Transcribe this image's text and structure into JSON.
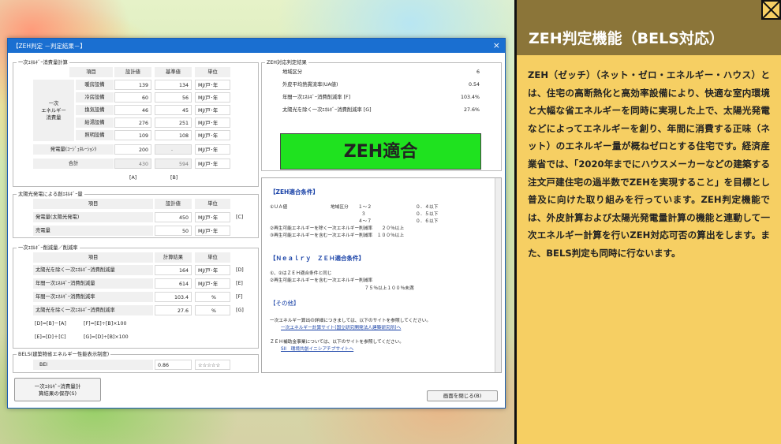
{
  "side_panel": {
    "title": "ZEH判定機能（BELS対応）",
    "body": "ZEH（ゼッチ）（ネット・ゼロ・エネルギー・ハウス）とは、住宅の高断熱化と高効率設備により、快適な室内環境と大幅な省エネルギーを同時に実現した上で、太陽光発電などによってエネルギーを創り、年間に消費する正味（ネット）のエネルギー量が概ねゼロとする住宅です。経済産業省では、「2020年までにハウスメーカーなどの建築する注文戸建住宅の過半数でZEHを実現すること」を目標とし普及に向けた取り組みを行っています。ZEH判定機能では、外皮計算および太陽光発電量計算の機能と連動して一次エネルギー計算を行いZEH対応可否の算出をします。また、BELS判定も同時に行ないます。"
  },
  "window": {
    "title": "【ZEH判定 －判定結果－】",
    "close": "×",
    "primary": {
      "label": "一次ｴﾈﾙｷﾞｰ消費量計算",
      "headers": [
        "項目",
        "設計値",
        "基準値",
        "単位"
      ],
      "group_label": "一次\nエネルギー\n消費量",
      "rows": [
        {
          "name": "暖房設備",
          "design": "139",
          "base": "134",
          "unit": "MJ/戸･年"
        },
        {
          "name": "冷房設備",
          "design": "60",
          "base": "56",
          "unit": "MJ/戸･年"
        },
        {
          "name": "換気設備",
          "design": "46",
          "base": "45",
          "unit": "MJ/戸･年"
        },
        {
          "name": "給湯設備",
          "design": "276",
          "base": "251",
          "unit": "MJ/戸･年"
        },
        {
          "name": "照明設備",
          "design": "109",
          "base": "108",
          "unit": "MJ/戸･年"
        }
      ],
      "cogen": {
        "name": "発電量(ｺｰｼﾞｪﾈﾚｰｼｮﾝ)",
        "design": "200",
        "base": "-",
        "unit": "MJ/戸･年"
      },
      "total": {
        "name": "合計",
        "design": "430",
        "base": "594",
        "unit": "MJ/戸･年"
      },
      "marks": [
        "[A]",
        "[B]"
      ]
    },
    "solar": {
      "label": "太陽光発電による創ｴﾈﾙｷﾞｰ量",
      "headers": [
        "項目",
        "設計値",
        "単位"
      ],
      "rows": [
        {
          "name": "発電量(太陽光発電)",
          "value": "450",
          "unit": "MJ/戸･年",
          "mark": "[C]"
        },
        {
          "name": "売電量",
          "value": "50",
          "unit": "MJ/戸･年",
          "mark": ""
        }
      ]
    },
    "reduction": {
      "label": "一次ｴﾈﾙｷﾞｰ削減量／削減率",
      "headers": [
        "項目",
        "計算結果",
        "単位"
      ],
      "rows": [
        {
          "name": "太陽光を除く一次ｴﾈﾙｷﾞｰ消費削減量",
          "value": "164",
          "unit": "MJ/戸･年",
          "mark": "[D]"
        },
        {
          "name": "年間一次ｴﾈﾙｷﾞｰ消費削減量",
          "value": "614",
          "unit": "MJ/戸･年",
          "mark": "[E]"
        },
        {
          "name": "年間一次ｴﾈﾙｷﾞｰ消費削減率",
          "value": "103.4",
          "unit": "%",
          "mark": "[F]"
        },
        {
          "name": "太陽光を除く一次ｴﾈﾙｷﾞｰ消費削減率",
          "value": "27.6",
          "unit": "%",
          "mark": "[G]"
        }
      ],
      "formulas": [
        "[D]=[B]－[A]",
        "[F]=[E]÷[B]×100",
        "[E]=[D]＋[C]",
        "[G]=[D]÷[B]×100"
      ]
    },
    "bels": {
      "label": "BELS(建築物省エネルギー性能表示制度)",
      "name": "BEI",
      "value": "0.86",
      "stars": "☆☆☆☆☆"
    },
    "save_button": "一次ｴﾈﾙｷﾞｰ消費量計\n算結果の保存(S)",
    "close_button": "画面を閉じる(B)",
    "result": {
      "label": "ZEH対応判定結果",
      "rows": [
        {
          "name": "地域区分",
          "value": "6"
        },
        {
          "name": "外皮平均熱貫流率(UA値)",
          "value": "0.54"
        },
        {
          "name": "年間一次ｴﾈﾙｷﾞｰ消費削減率 [F]",
          "value": "103.4%"
        },
        {
          "name": "太陽光を除く一次ｴﾈﾙｷﾞｰ消費削減率 [G]",
          "value": "27.6%"
        }
      ],
      "verdict": "ZEH適合"
    },
    "conditions": {
      "zeh_title": "【ZEH適合条件】",
      "ua_label": "①ＵＡ値",
      "region_label": "地域区分",
      "ua_rows": [
        {
          "region": "１～２",
          "value": "０．４以下"
        },
        {
          "region": "３",
          "value": "０．５以下"
        },
        {
          "region": "４～７",
          "value": "０．６以下"
        }
      ],
      "zeh_line2": "②再生可能エネルギーを除く一次エネルギー削減率　　２０％以上",
      "zeh_line3": "③再生可能エネルギーを含む一次エネルギー削減率　１００％以上",
      "nearly_title": "【Ｎｅａｌｒｙ　ＺＥＨ適合条件】",
      "nearly_line1": "①、②はＺＥＨ適合条件と同じ",
      "nearly_line2": "②再生可能エネルギーを含む一次エネルギー削減率",
      "nearly_line3": "７５％以上１００％未満",
      "other_title": "【その他】",
      "other_line1": "一次エネルギー算出の詳細につきましては、以下のサイトを参照してください。",
      "other_link1": "一次エネルギー計算サイト(国立研究開発法人建築研究所)へ",
      "other_line2": "ＺＥＨ補助金事業については、以下のサイトを参照してください。",
      "other_link2": "SII　環境共創イニシアチブサイトへ"
    }
  }
}
